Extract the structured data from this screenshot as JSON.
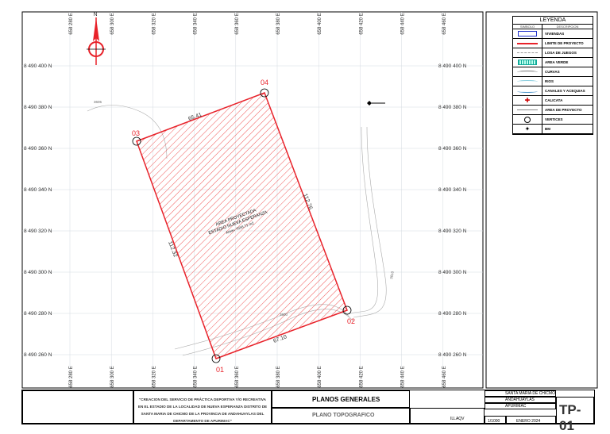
{
  "north_label": "N",
  "eastings": [
    "658 280 E",
    "658 300 E",
    "658 320 E",
    "658 340 E",
    "658 360 E",
    "658 380 E",
    "658 400 E",
    "658 420 E",
    "658 440 E",
    "658 460 E"
  ],
  "northings": [
    "8 490 400 N",
    "8 490 380 N",
    "8 490 360 N",
    "8 490 340 N",
    "8 490 320 N",
    "8 490 300 N",
    "8 490 280 N",
    "8 490 260 N"
  ],
  "vertices": [
    {
      "id": "01"
    },
    {
      "id": "02"
    },
    {
      "id": "04"
    },
    {
      "id": "03"
    }
  ],
  "sides": [
    "67.10",
    "112.76",
    "65.41",
    "112.32"
  ],
  "area": {
    "line1": "AREA PROYECTADA",
    "line2": "ESTADIO NUEVA ESPERANZA",
    "line3": "Area= 7556.71 m2"
  },
  "contours": [
    "3605",
    "3610",
    "3600"
  ],
  "legend": {
    "title": "LEYENDA",
    "col_symbol": "SIMBOLO",
    "col_desc": "DESCRIPCION",
    "items": [
      "VIVIENDAS",
      "LIMITE DE PROYECTO",
      "LOSA DE JUEGOS",
      "AREA VERDE",
      "CURVAS",
      "RIOS",
      "CANALES Y ACEQUIAS",
      "CALICATA",
      "AREA DE PROYECTO",
      "VERTICES",
      "BM"
    ]
  },
  "title_block": {
    "project": "\"CREACION DEL SERVICIO DE PRÁCTICA DEPORTIVA Y/O RECREATIVA EN EL ESTADIO DE LA LOCALIDAD DE NUEVA ESPERANZA DISTRITO DE SANTA MARIA DE CHICMO DE LA PROVINCIA DE ANDAHUAYLAS DEL DEPARTAMENTO DE APURIMAC\"",
    "sheet_group": "PLANOS GENERALES",
    "sheet_name": "PLANO TOPOGRAFICO",
    "district": "SANTA MARIA DE CHICMO",
    "province": "ANDAHUAYLAS",
    "region": "APURIMAC",
    "drawn": "ILLAQV",
    "scale": "1/1000",
    "date": "ENERO 2024",
    "code": "TP-01"
  },
  "colors": {
    "boundary": "#e8222a",
    "hatch": "#f05a5a",
    "grid": "#cfd6dc",
    "label": "#e8222a"
  }
}
